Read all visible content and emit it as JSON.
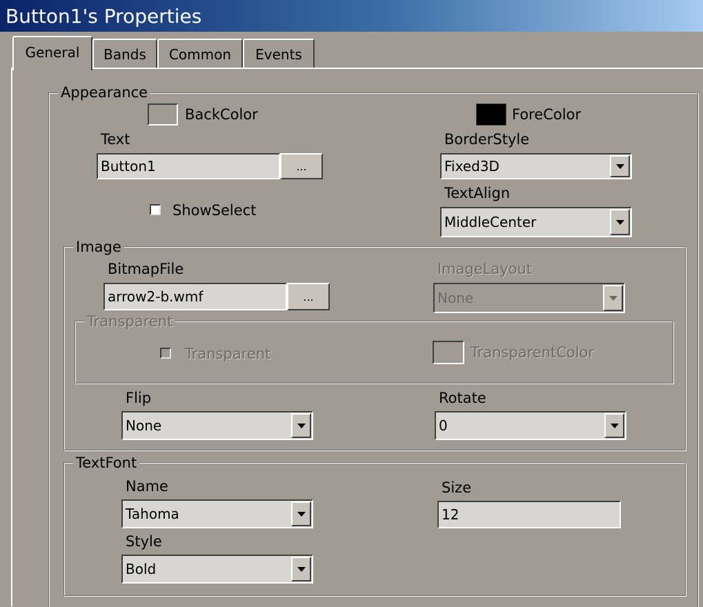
{
  "window": {
    "title": "Button1's Properties"
  },
  "tabs": [
    "General",
    "Bands",
    "Common",
    "Events"
  ],
  "appearance": {
    "legend": "Appearance",
    "backcolor": {
      "label": "BackColor",
      "value": "#a09c94"
    },
    "forecolor": {
      "label": "ForeColor",
      "value": "#000000"
    },
    "text": {
      "label": "Text",
      "value": "Button1",
      "browse": "..."
    },
    "borderstyle": {
      "label": "BorderStyle",
      "value": "Fixed3D"
    },
    "textalign": {
      "label": "TextAlign",
      "value": "MiddleCenter"
    },
    "showselect": {
      "label": "ShowSelect",
      "checked": false
    }
  },
  "image": {
    "legend": "Image",
    "bitmapfile": {
      "label": "BitmapFile",
      "value": "arrow2-b.wmf",
      "browse": "..."
    },
    "imagelayout": {
      "label": "ImageLayout",
      "value": "None",
      "disabled": true
    },
    "transparent_group": {
      "legend": "Transparent",
      "transparent": {
        "label": "Transparent",
        "checked": false,
        "disabled": true
      },
      "transparentcolor": {
        "label": "TransparentColor",
        "disabled": true
      }
    },
    "flip": {
      "label": "Flip",
      "value": "None"
    },
    "rotate": {
      "label": "Rotate",
      "value": "0"
    }
  },
  "textfont": {
    "legend": "TextFont",
    "name": {
      "label": "Name",
      "value": "Tahoma"
    },
    "size": {
      "label": "Size",
      "value": "12"
    },
    "style": {
      "label": "Style",
      "value": "Bold"
    }
  }
}
